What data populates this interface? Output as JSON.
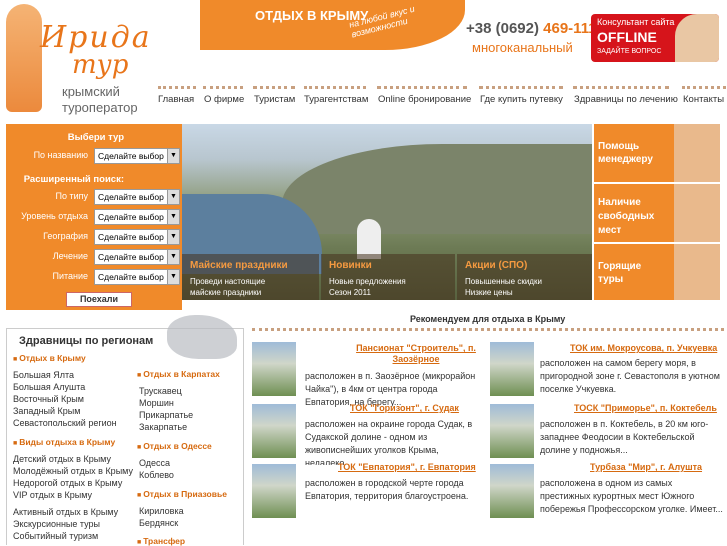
{
  "logo": {
    "name": "Ирида",
    "name2": "тур",
    "sub1": "крымский",
    "sub2": "туроператор"
  },
  "banner": {
    "title": "ОТДЫХ В КРЫМУ",
    "subtitle": "на любой вкус и возможности"
  },
  "phone": {
    "prefix": "+38 (0692)",
    "number": "469-111",
    "note": "многоканальный"
  },
  "consultant": {
    "line1": "Консультант сайта",
    "status": "OFFLINE",
    "line3": "ЗАДАЙТЕ ВОПРОС"
  },
  "nav": [
    "Главная",
    "О фирме",
    "Туристам",
    "Турагентствам",
    "Online бронирование",
    "Где купить путевку",
    "Здравницы по лечению",
    "Контакты"
  ],
  "form": {
    "title": "Выбери тур",
    "by_name_label": "По названию",
    "ext_title": "Расширенный поиск:",
    "fields": [
      {
        "label": "По типу",
        "value": "Сделайте выбор"
      },
      {
        "label": "Уровень отдыха",
        "value": "Сделайте выбор"
      },
      {
        "label": "География",
        "value": "Сделайте выбор"
      },
      {
        "label": "Лечение",
        "value": "Сделайте выбор"
      },
      {
        "label": "Питание",
        "value": "Сделайте выбор"
      }
    ],
    "by_name_value": "Сделайте выбор",
    "submit": "Поехали"
  },
  "promos": [
    {
      "title": "Майские праздники",
      "line1": "Проведи настоящие",
      "line2": "майские праздники"
    },
    {
      "title": "Новинки",
      "line1": "Новые предложения",
      "line2": "Сезон 2011"
    },
    {
      "title": "Акции (СПО)",
      "line1": "Повышенные скидки",
      "line2": "Низкие цены"
    }
  ],
  "side_boxes": [
    {
      "title1": "Помощь",
      "title2": "менеджеру",
      "title3": ""
    },
    {
      "title1": "Наличие",
      "title2": "свободных",
      "title3": "мест"
    },
    {
      "title1": "Горящие",
      "title2": "туры",
      "title3": ""
    }
  ],
  "regions": {
    "title": "Здравницы по регионам",
    "col1": [
      {
        "type": "h",
        "text": "Отдых в Крыму"
      },
      {
        "type": "i",
        "text": "Большая Ялта"
      },
      {
        "type": "i",
        "text": "Большая Алушта"
      },
      {
        "type": "i",
        "text": "Восточный Крым"
      },
      {
        "type": "i",
        "text": "Западный Крым"
      },
      {
        "type": "i",
        "text": "Севастопольский регион"
      },
      {
        "type": "h",
        "text": "Виды отдыха в Крыму"
      },
      {
        "type": "i",
        "text": "Детский отдых в Крыму"
      },
      {
        "type": "i",
        "text": "Молодёжный отдых в Крыму"
      },
      {
        "type": "i",
        "text": "Недорогой отдых в Крыму"
      },
      {
        "type": "i",
        "text": "VIP отдых в Крыму"
      },
      {
        "type": "i",
        "text": "Активный отдых в Крыму"
      },
      {
        "type": "i",
        "text": "Экскурсионные туры"
      },
      {
        "type": "i",
        "text": "Событийный туризм"
      }
    ],
    "col2": [
      {
        "type": "h",
        "text": "Отдых в Карпатах"
      },
      {
        "type": "i",
        "text": "Трускавец"
      },
      {
        "type": "i",
        "text": "Моршин"
      },
      {
        "type": "i",
        "text": "Прикарпатье"
      },
      {
        "type": "i",
        "text": "Закарпатье"
      },
      {
        "type": "h",
        "text": "Отдых в Одессе"
      },
      {
        "type": "i",
        "text": "Одесса"
      },
      {
        "type": "i",
        "text": "Коблево"
      },
      {
        "type": "h",
        "text": "Отдых в Приазовье"
      },
      {
        "type": "i",
        "text": "Кириловка"
      },
      {
        "type": "i",
        "text": "Бердянск"
      },
      {
        "type": "h",
        "text": "Трансфер"
      }
    ]
  },
  "recommended": {
    "title": "Рекомендуем для отдыха в Крыму",
    "items": [
      {
        "title": "Пансионат \"Строитель\", п. Заозёрное",
        "desc": "расположен в п. Заозёрное (микрорайон Чайка\"), в 4км от центра города Евпатория, на берегу..."
      },
      {
        "title": "ТОК им. Мокроусова, п. Учкуевка",
        "desc": "расположен на самом берегу моря, в пригородной зоне г. Севастополя в уютном поселке Учкуевка."
      },
      {
        "title": "ТОК \"Горизонт\", г. Судак",
        "desc": "расположен на окраине города Судак, в Судакской долине - одном из живописнейших уголков Крыма, недалеко..."
      },
      {
        "title": "ТОСК \"Приморье\", п. Коктебель",
        "desc": "расположен в п. Коктебель, в 20 км юго-западнее Феодосии в Коктебельской долине у подножья..."
      },
      {
        "title": "ТОК \"Евпатория\", г. Евпатория",
        "desc": "расположен в городской черте города Евпатория, территория благоустроена."
      },
      {
        "title": "Турбаза \"Мир\", г. Алушта",
        "desc": "расположена в одном из самых престижных курортных мест Южного побережья Профессорском уголке. Имеет..."
      }
    ]
  },
  "colors": {
    "accent": "#f08a2a",
    "link": "#d66a10",
    "consult_bg": "#d6141b"
  }
}
